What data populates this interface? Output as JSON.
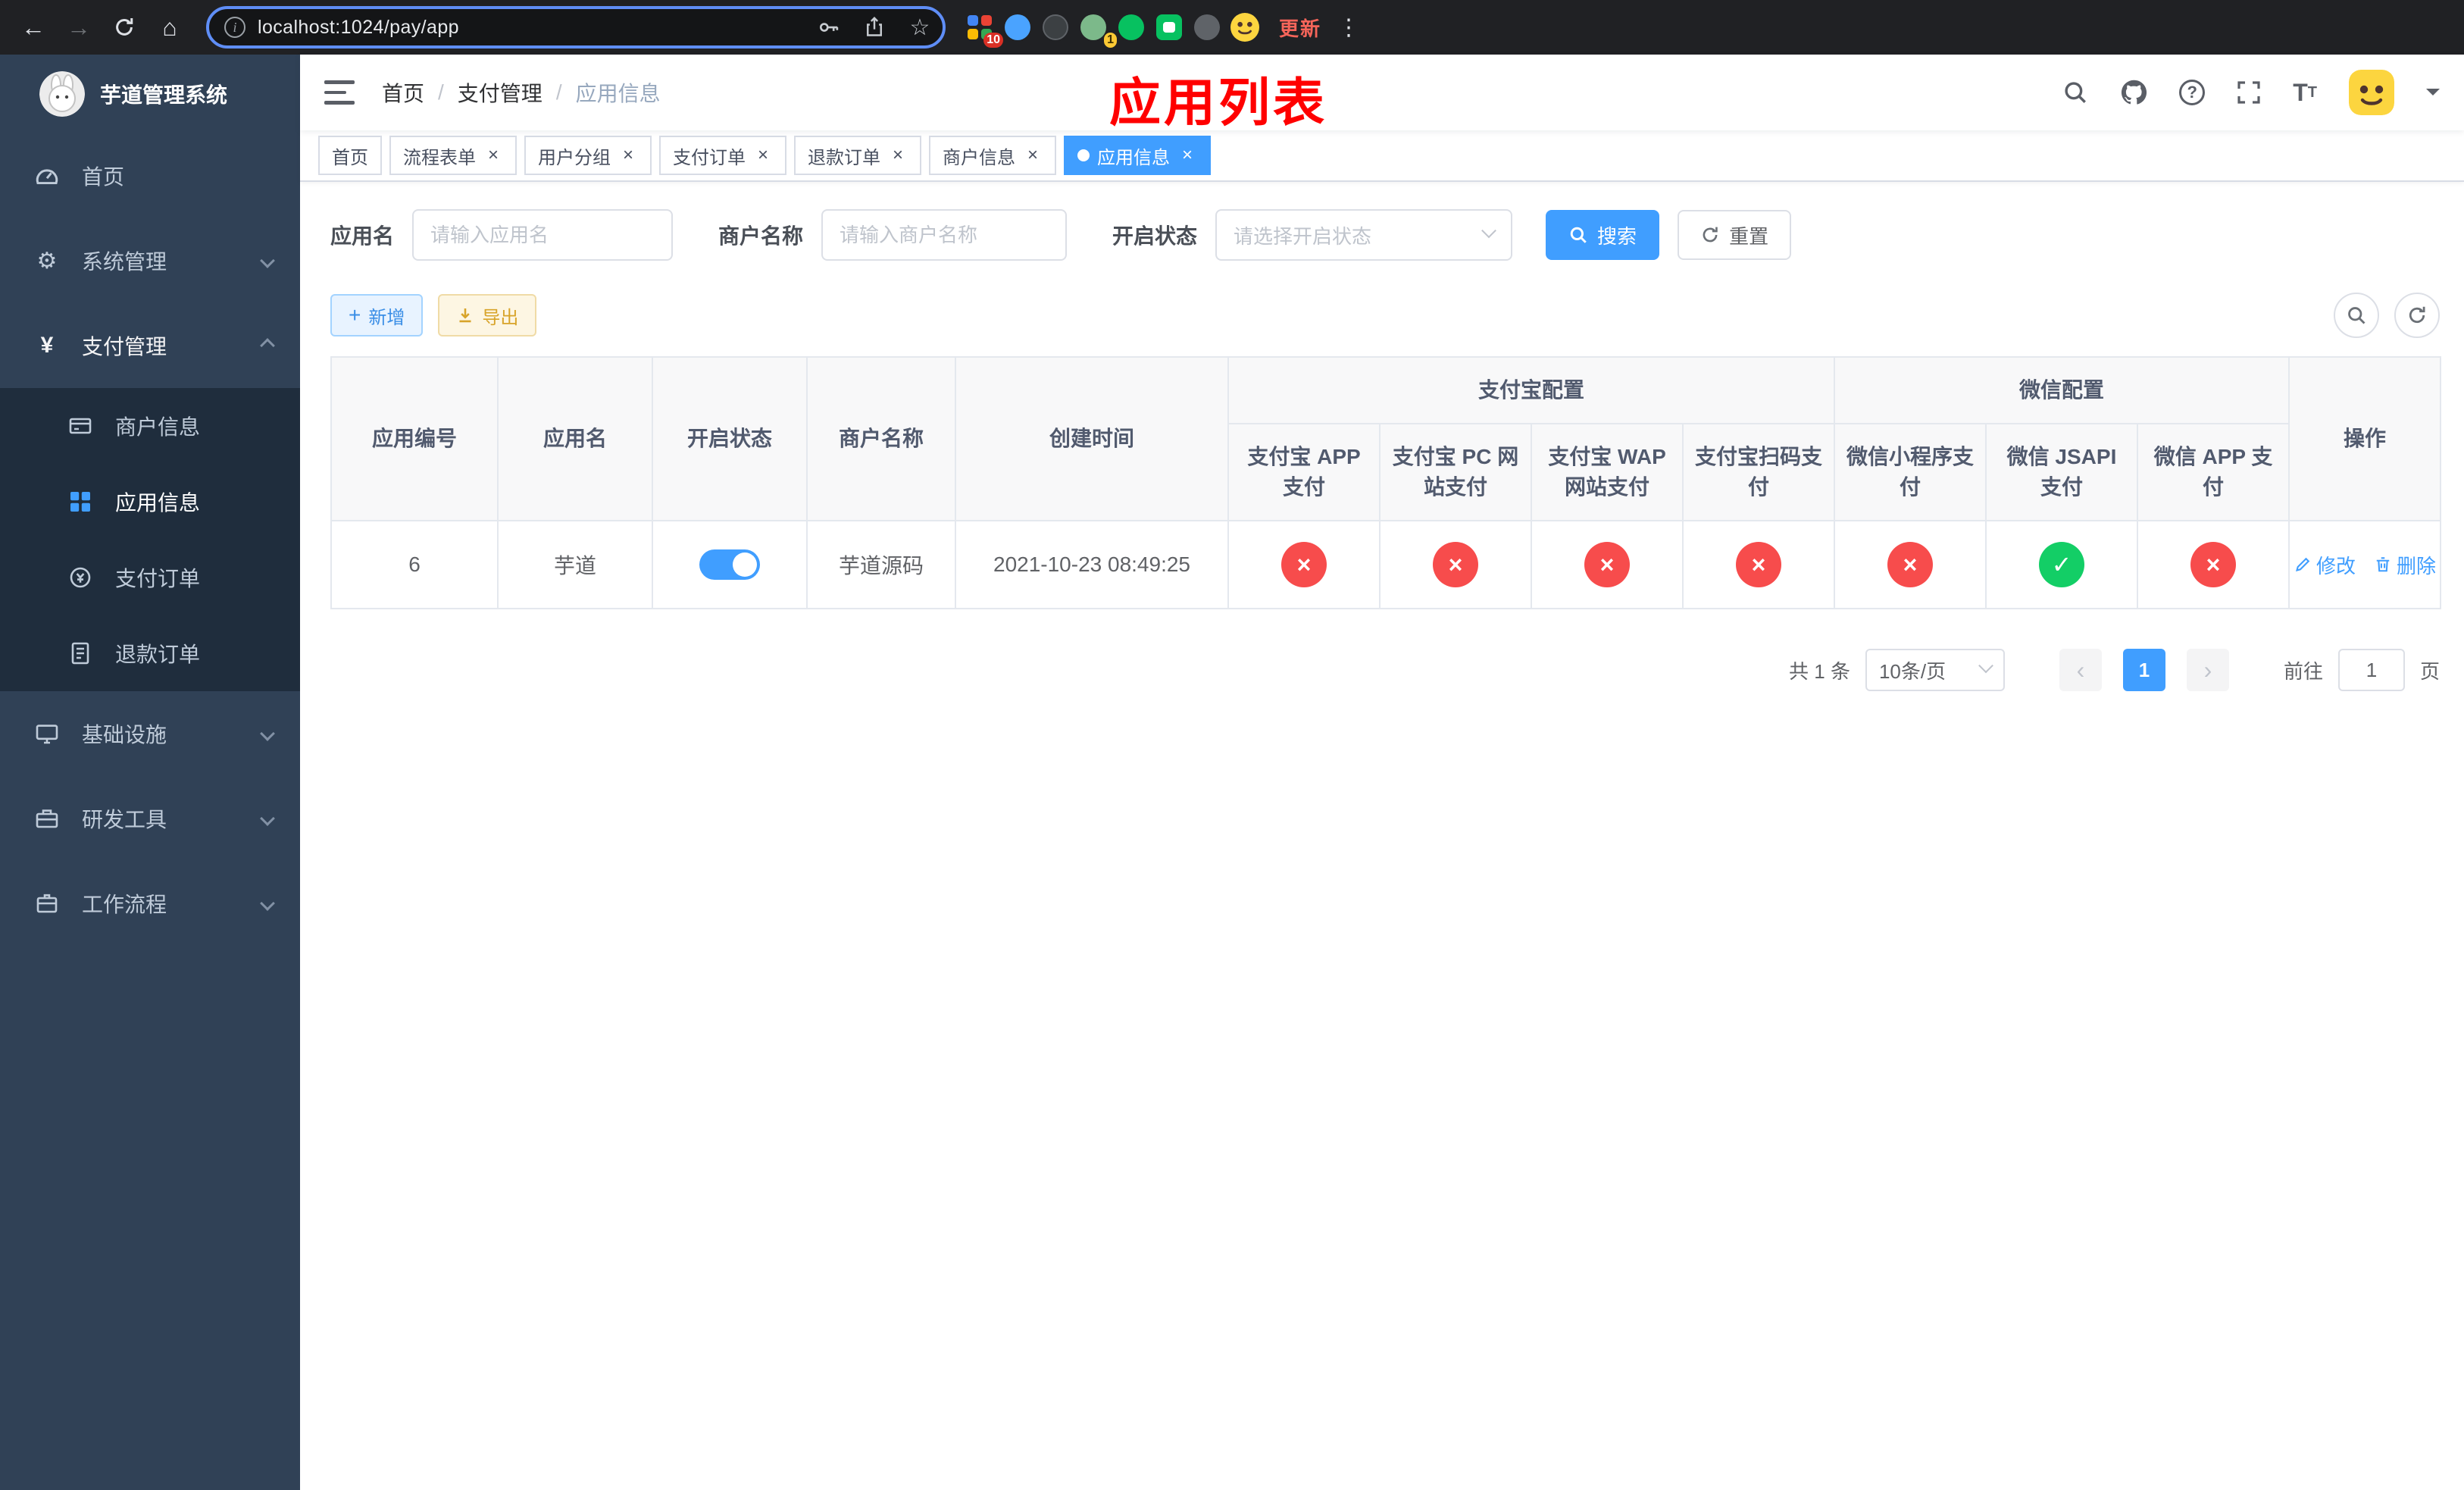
{
  "colors": {
    "accent": "#409eff",
    "success": "#13ce66",
    "danger": "#f74c4c",
    "sidebar_bg": "#304156",
    "annotation_red": "#ff0000"
  },
  "browser": {
    "url": "localhost:1024/pay/app",
    "update_label": "更新",
    "extension_badge_count": "10",
    "profile_badge_count": "1"
  },
  "sidebar": {
    "app_title": "芋道管理系统",
    "items": [
      {
        "label": "首页"
      },
      {
        "label": "系统管理"
      },
      {
        "label": "支付管理",
        "children": [
          {
            "label": "商户信息"
          },
          {
            "label": "应用信息"
          },
          {
            "label": "支付订单"
          },
          {
            "label": "退款订单"
          }
        ]
      },
      {
        "label": "基础设施"
      },
      {
        "label": "研发工具"
      },
      {
        "label": "工作流程"
      }
    ]
  },
  "header": {
    "breadcrumb": [
      "首页",
      "支付管理",
      "应用信息"
    ],
    "overlay_title": "应用列表"
  },
  "tabs": [
    {
      "label": "首页",
      "closable": false,
      "active": false
    },
    {
      "label": "流程表单",
      "closable": true,
      "active": false
    },
    {
      "label": "用户分组",
      "closable": true,
      "active": false
    },
    {
      "label": "支付订单",
      "closable": true,
      "active": false
    },
    {
      "label": "退款订单",
      "closable": true,
      "active": false
    },
    {
      "label": "商户信息",
      "closable": true,
      "active": false
    },
    {
      "label": "应用信息",
      "closable": true,
      "active": true
    }
  ],
  "filters": {
    "app_name_label": "应用名",
    "app_name_placeholder": "请输入应用名",
    "merchant_label": "商户名称",
    "merchant_placeholder": "请输入商户名称",
    "status_label": "开启状态",
    "status_placeholder": "请选择开启状态",
    "search_label": "搜索",
    "reset_label": "重置"
  },
  "toolbar": {
    "add_label": "新增",
    "export_label": "导出"
  },
  "table": {
    "group_alipay": "支付宝配置",
    "group_wechat": "微信配置",
    "columns": [
      "应用编号",
      "应用名",
      "开启状态",
      "商户名称",
      "创建时间",
      "支付宝 APP 支付",
      "支付宝 PC 网站支付",
      "支付宝 WAP 网站支付",
      "支付宝扫码支付",
      "微信小程序支付",
      "微信 JSAPI 支付",
      "微信 APP 支付",
      "操作"
    ],
    "rows": [
      {
        "id": "6",
        "name": "芋道",
        "enabled": true,
        "merchant": "芋道源码",
        "created_at": "2021-10-23 08:49:25",
        "statuses": [
          false,
          false,
          false,
          false,
          false,
          true,
          false
        ],
        "actions": [
          "修改",
          "删除"
        ]
      }
    ]
  },
  "pagination": {
    "total": "共 1 条",
    "page_size": "10条/页",
    "prev": "‹",
    "next": "›",
    "current_page": "1",
    "goto_label": "前往",
    "goto_value": "1",
    "page_unit": "页"
  }
}
